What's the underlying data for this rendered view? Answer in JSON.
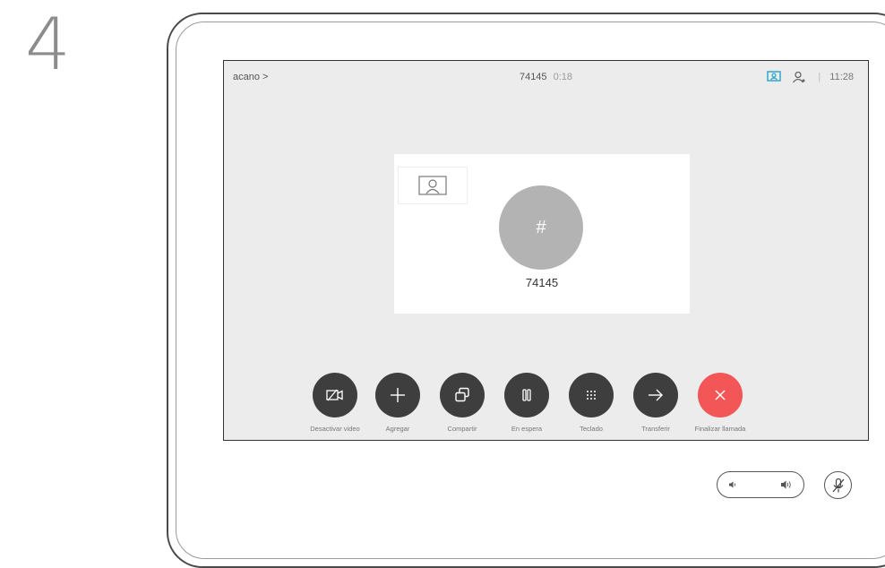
{
  "step": {
    "number": "4"
  },
  "statusbar": {
    "left_label": "acano >",
    "call_number": "74145",
    "call_timer": "0:18",
    "time": "11:28",
    "separator": "|",
    "icons": [
      "screen-share-icon",
      "contacts-icon"
    ]
  },
  "participant": {
    "avatar_symbol": "#",
    "name": "74145"
  },
  "controls": [
    {
      "label": "Desactivar video",
      "icon": "camera-off-icon"
    },
    {
      "label": "Agregar",
      "icon": "plus-icon"
    },
    {
      "label": "Compartir",
      "icon": "share-icon"
    },
    {
      "label": "En espera",
      "icon": "hold-icon"
    },
    {
      "label": "Teclado",
      "icon": "keypad-icon"
    },
    {
      "label": "Transferir",
      "icon": "transfer-icon"
    },
    {
      "label": "Finalizar llamada",
      "icon": "end-call-icon"
    }
  ],
  "colors": {
    "accent": "#2ea8c8",
    "end_call": "#f25656",
    "button": "#3e3e3e",
    "screen_bg": "#ececec"
  }
}
